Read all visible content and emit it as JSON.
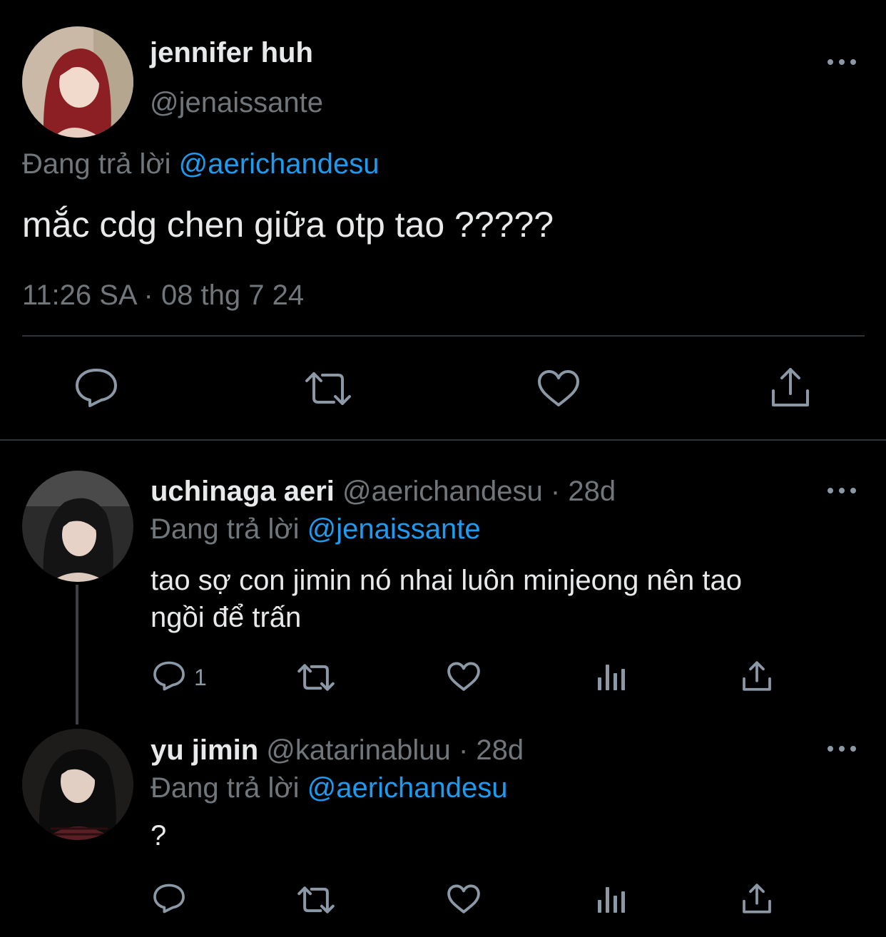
{
  "main_tweet": {
    "display_name": "jennifer huh",
    "handle": "@jenaissante",
    "replying_prefix": "Đang trả lời",
    "replying_to": "@aerichandesu",
    "text": "mắc cdg chen giữa otp tao ?????",
    "timestamp": "11:26 SA · 08 thg 7 24",
    "actions": [
      "reply-icon",
      "retweet-icon",
      "like-icon",
      "share-icon"
    ]
  },
  "replies": [
    {
      "display_name": "uchinaga aeri",
      "handle": "@aerichandesu",
      "age": "· 28d",
      "replying_prefix": "Đang trả lời",
      "replying_to": "@jenaissante",
      "text_line1": "tao sợ con jimin nó nhai luôn minjeong nên tao",
      "text_line2": "ngồi để trấn",
      "reply_count": "1"
    },
    {
      "display_name": "yu jimin",
      "handle": "@katarinabluu",
      "age": "· 28d",
      "replying_prefix": "Đang trả lời",
      "replying_to": "@aerichandesu",
      "text": "?"
    }
  ],
  "colors": {
    "background": "#000000",
    "text": "#e7e9ea",
    "muted": "#71767b",
    "link": "#1d9bf0",
    "icon": "#8b98a5",
    "divider": "#2f3336"
  }
}
